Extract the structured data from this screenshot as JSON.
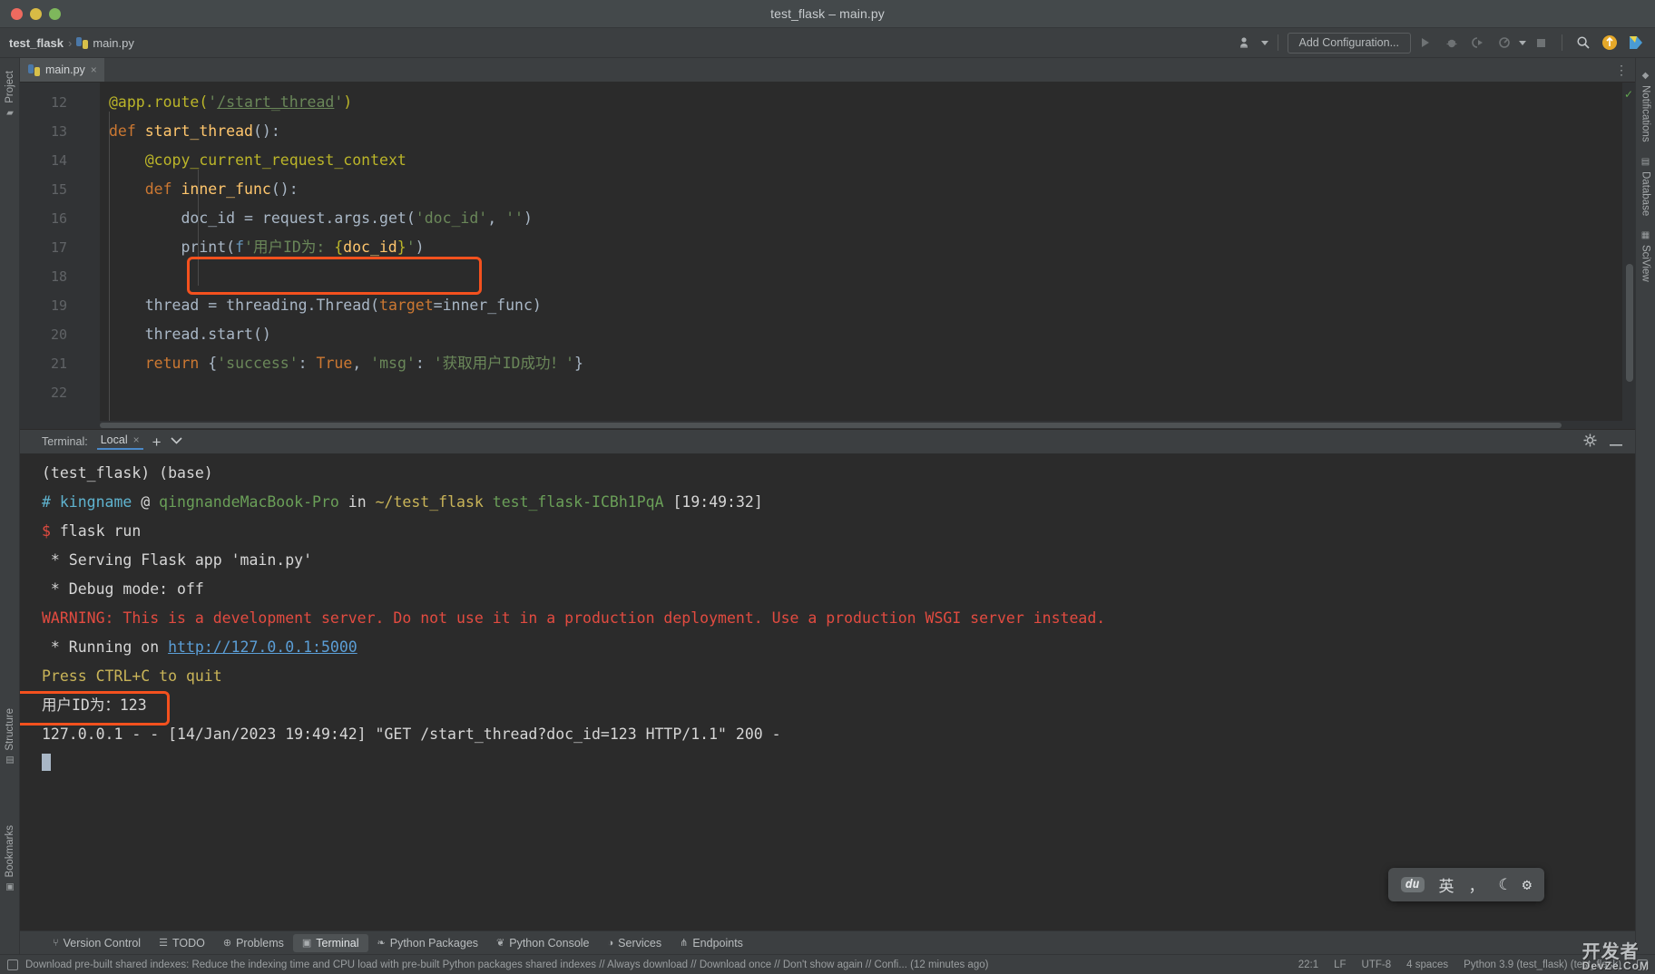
{
  "window": {
    "title": "test_flask – main.py",
    "traffic_lights": [
      "close-red",
      "minimize-yellow",
      "maximize-green"
    ]
  },
  "navbar": {
    "project": "test_flask",
    "separator": "›",
    "file": "main.py",
    "add_configuration": "Add Configuration...",
    "icons": [
      "user-dropdown-icon",
      "run-icon",
      "debug-icon",
      "run-coverage-icon",
      "profile-icon",
      "more-dropdown-icon",
      "stop-icon",
      "search-icon",
      "updates-icon",
      "ide-feature-icon"
    ]
  },
  "left_rail": {
    "tabs": [
      "Project",
      "Structure",
      "Bookmarks"
    ]
  },
  "right_rail": {
    "tabs": [
      "Notifications",
      "Database",
      "SciView"
    ]
  },
  "editor": {
    "tab": {
      "label": "main.py",
      "close": "×",
      "icon": "python-file-icon"
    },
    "options_icon": "editor-options-icon",
    "inspection_status": "✓",
    "lines": [
      {
        "num": "12",
        "fold": false,
        "html": "<span class=\"s-dec\">@app.route(</span><span class=\"s-str\">'</span><span class=\"s-link\">/start_thread</span><span class=\"s-str\">'</span><span class=\"s-dec\">)</span>"
      },
      {
        "num": "13",
        "fold": true,
        "html": "<span class=\"s-kw\">def</span> <span class=\"s-fn\">start_thread</span><span class=\"s-punct\">():</span>"
      },
      {
        "num": "14",
        "fold": false,
        "html": "    <span class=\"s-dec\">@copy_current_request_context</span>"
      },
      {
        "num": "15",
        "fold": true,
        "html": "    <span class=\"s-kw\">def</span> <span class=\"s-fn\">inner_func</span><span class=\"s-punct\">():</span>"
      },
      {
        "num": "16",
        "fold": false,
        "html": "        <span class=\"s-def\">doc_id = request.args.get(</span><span class=\"s-str\">'doc_id'</span><span class=\"s-def\">, </span><span class=\"s-str\">''</span><span class=\"s-def\">)</span>"
      },
      {
        "num": "17",
        "fold": true,
        "html": "        <span class=\"s-def\">print(</span><span class=\"s-num\">f</span><span class=\"s-str\">'用户ID为: </span><span class=\"s-fstr-b\">{</span><span class=\"s-fn\">doc_id</span><span class=\"s-fstr-b\">}</span><span class=\"s-str\">'</span><span class=\"s-def\">)</span>"
      },
      {
        "num": "18",
        "fold": false,
        "html": ""
      },
      {
        "num": "19",
        "fold": false,
        "html": "    <span class=\"s-def\">thread = threading.Thread(</span><span class=\"s-kwarg\">target</span><span class=\"s-def\">=inner_func)</span>"
      },
      {
        "num": "20",
        "fold": false,
        "html": "    <span class=\"s-def\">thread.start()</span>"
      },
      {
        "num": "21",
        "fold": true,
        "html": "    <span class=\"s-kw\">return</span> <span class=\"s-brace\">{</span><span class=\"s-str\">'success'</span><span class=\"s-punct\">: </span><span class=\"s-kw\">True</span><span class=\"s-punct\">, </span><span class=\"s-str\">'msg'</span><span class=\"s-punct\">: </span><span class=\"s-str\">'获取用户ID成功！'</span><span class=\"s-brace\">}</span>"
      },
      {
        "num": "22",
        "fold": false,
        "html": ""
      }
    ],
    "highlight_note": "red-rectangle-around-print-statement"
  },
  "terminal": {
    "label": "Terminal:",
    "tab": "Local",
    "tab_close": "×",
    "add": "+",
    "chevron": "⌄",
    "settings_icon": "gear-icon",
    "minimize_icon": "minimize-icon",
    "lines": [
      {
        "html": "<span class=\"t-white\">(test_flask) (base)</span>"
      },
      {
        "html": "<span class=\"t-cyan\">#</span> <span class=\"t-cyan\">kingname</span> <span class=\"t-white\">@</span> <span class=\"t-green\">qingnandeMacBook-Pro</span> <span class=\"t-white\">in</span> <span class=\"t-yellow\">~/test_flask</span> <span class=\"t-green\">test_flask-ICBh1PqA</span> <span class=\"t-white\">[19:49:32]</span>"
      },
      {
        "html": "<span class=\"t-red\">$</span> <span class=\"t-white\">flask run</span>"
      },
      {
        "html": "<span class=\"t-white\"> * Serving Flask app 'main.py'</span>"
      },
      {
        "html": "<span class=\"t-white\"> * Debug mode: off</span>"
      },
      {
        "html": "<span class=\"t-red\">WARNING: This is a development server. Do not use it in a production deployment. Use a production WSGI server instead.</span>"
      },
      {
        "html": "<span class=\"t-white\"> * Running on </span><span class=\"t-blue\">http://127.0.0.1:5000</span>"
      },
      {
        "html": "<span class=\"t-yellow\">Press CTRL+C to quit</span>"
      },
      {
        "html": "<span class=\"t-white\">用户ID为：123</span>"
      },
      {
        "html": "<span class=\"t-white\">127.0.0.1 - - [14/Jan/2023 19:49:42] \"GET /start_thread?doc_id=123 HTTP/1.1\" 200 -</span>"
      },
      {
        "html": "<span class=\"cursor-block\"></span>"
      }
    ],
    "highlight_note": "red-rectangle-around-user-id-output"
  },
  "ime": {
    "logo": "du",
    "mode": "英",
    "punct": "，",
    "moon": "☾",
    "gear": "⚙"
  },
  "bottom_tabs": [
    {
      "label": "Version Control",
      "icon": "branch-icon",
      "active": false
    },
    {
      "label": "TODO",
      "icon": "list-icon",
      "active": false
    },
    {
      "label": "Problems",
      "icon": "warning-icon",
      "active": false
    },
    {
      "label": "Terminal",
      "icon": "terminal-icon",
      "active": true
    },
    {
      "label": "Python Packages",
      "icon": "package-icon",
      "active": false
    },
    {
      "label": "Python Console",
      "icon": "console-icon",
      "active": false
    },
    {
      "label": "Services",
      "icon": "services-icon",
      "active": false
    },
    {
      "label": "Endpoints",
      "icon": "endpoints-icon",
      "active": false
    }
  ],
  "statusbar": {
    "message": "Download pre-built shared indexes: Reduce the indexing time and CPU load with pre-built Python packages shared indexes // Always download // Download once // Don't show again // Confi... (12 minutes ago)",
    "caret": "22:1",
    "line_sep": "LF",
    "encoding": "UTF-8",
    "indent": "4 spaces",
    "interpreter": "Python 3.9 (test_flask) (test_flask)",
    "lock_icon": "lock-icon",
    "notice_icon": "notice-icon"
  },
  "watermark": {
    "main": "开发者",
    "sub": "DevZe.CoM"
  }
}
